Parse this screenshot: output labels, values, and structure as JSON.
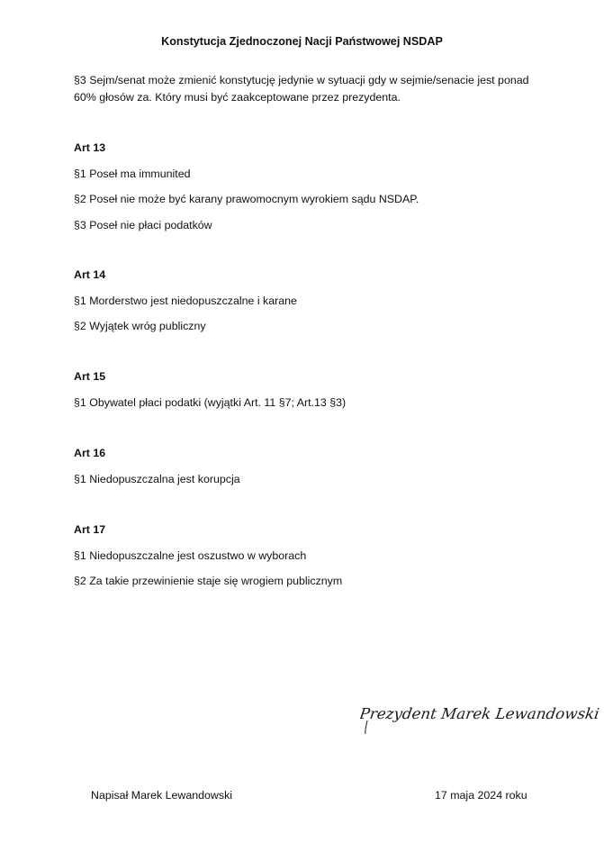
{
  "document": {
    "title": "Konstytucja Zjednoczonej Nacji Państwowej NSDAP",
    "intro_paragraph": "§3 Sejm/senat może zmienić konstytucję jedynie w sytuacji gdy w sejmie/senacie jest ponad 60% głosów za. Który musi być zaakceptowane przez prezydenta.",
    "articles": [
      {
        "heading": "Art 13",
        "paragraphs": [
          "§1 Poseł ma immunited",
          "§2 Poseł nie może być karany prawomocnym wyrokiem sądu NSDAP.",
          "§3 Poseł nie płaci podatków"
        ]
      },
      {
        "heading": "Art 14",
        "paragraphs": [
          "§1 Morderstwo jest niedopuszczalne i karane",
          "§2 Wyjątek wróg publiczny"
        ]
      },
      {
        "heading": "Art 15",
        "paragraphs": [
          "§1 Obywatel płaci podatki (wyjątki Art. 11 §7; Art.13 §3)"
        ]
      },
      {
        "heading": "Art 16",
        "paragraphs": [
          "§1 Niedopuszczalna jest korupcja"
        ]
      },
      {
        "heading": "Art 17",
        "paragraphs": [
          "§1 Niedopuszczalne jest oszustwo w wyborach",
          "§2 Za takie przewinienie staje się wrogiem publicznym"
        ]
      }
    ],
    "signature_text": "Prezydent Marek Lewandowski",
    "footer_author": "Napisał Marek Lewandowski",
    "footer_date": "17 maja 2024 roku"
  }
}
